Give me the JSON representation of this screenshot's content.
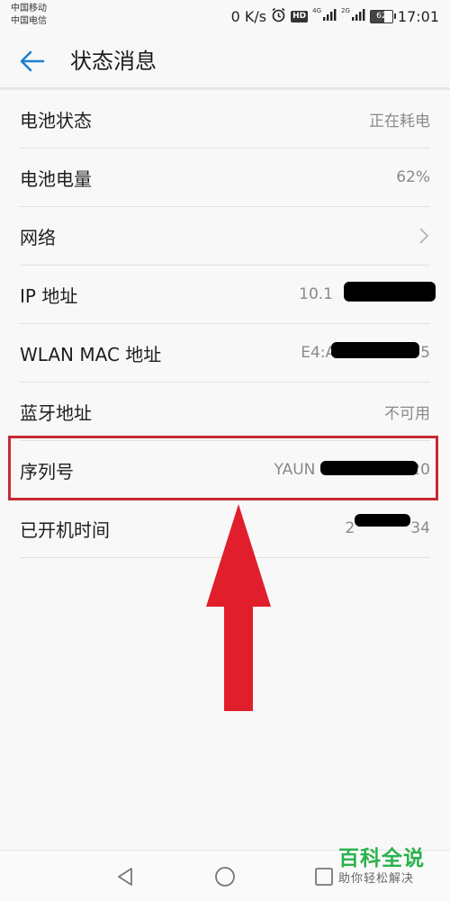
{
  "status_bar": {
    "carrier_1": "中国移动",
    "carrier_2": "中国电信",
    "net_speed": "0 K/s",
    "hd": "HD",
    "net_1": "4G",
    "net_2": "2G",
    "battery_level": "62",
    "battery_fraction": 0.62,
    "time": "17:01"
  },
  "header": {
    "title": "状态消息"
  },
  "rows": [
    {
      "label": "电池状态",
      "value": "正在耗电"
    },
    {
      "label": "电池电量",
      "value": "62%"
    },
    {
      "label": "网络",
      "value": ""
    },
    {
      "label": "IP 地址",
      "value": "10.1"
    },
    {
      "label": "WLAN MAC 地址",
      "value": "E4:A",
      "value_suffix": "5"
    },
    {
      "label": "蓝牙地址",
      "value": "不可用"
    },
    {
      "label": "序列号",
      "value": "YAUN",
      "value_suffix": "20"
    },
    {
      "label": "已开机时间",
      "value": "2",
      "value_suffix": "34"
    }
  ],
  "watermark": {
    "brand": "百科全说",
    "slogan": "助你轻松解决"
  },
  "colors": {
    "accent": "#1a7fd0",
    "highlight": "#c62a35",
    "arrow": "#e11f2c",
    "watermark": "#2bb24c"
  }
}
